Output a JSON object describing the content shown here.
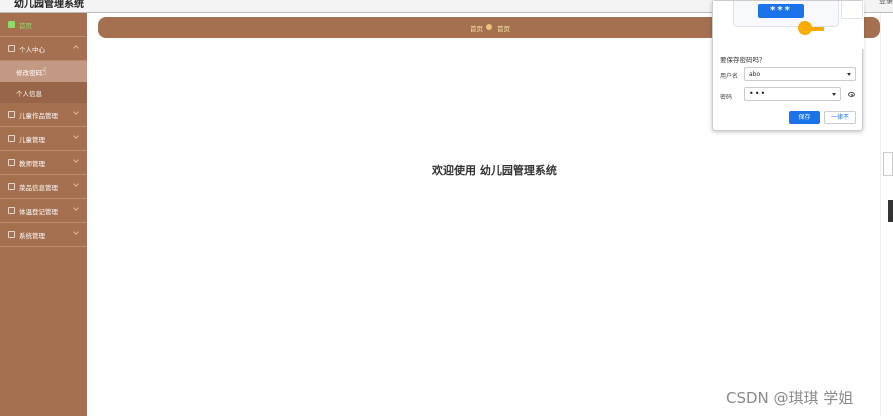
{
  "header": {
    "title": "幼儿园管理系统",
    "logout": "登录"
  },
  "sidebar": {
    "items": [
      {
        "label": "首页",
        "icon": "home-icon"
      },
      {
        "label": "个人中心",
        "icon": "user-icon"
      },
      {
        "label": "儿童作品管理",
        "icon": "grid-icon"
      },
      {
        "label": "儿童管理",
        "icon": "grid-icon"
      },
      {
        "label": "教师管理",
        "icon": "grid-icon"
      },
      {
        "label": "菜品信息管理",
        "icon": "grid-icon"
      },
      {
        "label": "体温登记管理",
        "icon": "grid-icon"
      },
      {
        "label": "系统管理",
        "icon": "grid-icon"
      }
    ],
    "submenu": [
      {
        "label": "修改密码"
      },
      {
        "label": "个人信息"
      }
    ]
  },
  "breadcrumb": {
    "first": "首页",
    "second": "首页"
  },
  "main": {
    "welcome": "欢迎使用 幼儿园管理系统"
  },
  "password_popup": {
    "stars": "***",
    "question": "要保存密码吗？",
    "username_label": "用户名",
    "username_value": "abo",
    "password_label": "密码",
    "password_value": "•••",
    "save_label": "保存",
    "never_label": "一律不"
  },
  "watermark": "CSDN @琪琪 学姐",
  "colors": {
    "sidebar": "#a5704f",
    "accent": "#1a73e8",
    "home_active": "#8fdc6b"
  }
}
